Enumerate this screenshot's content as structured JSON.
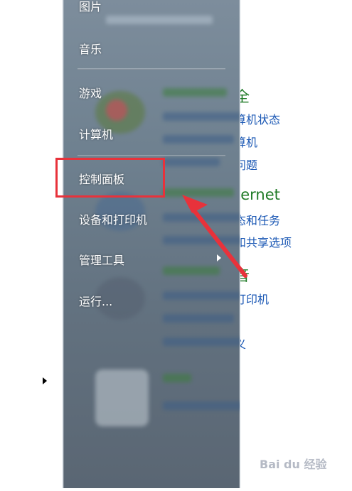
{
  "start_menu": {
    "items": [
      {
        "label": "图片"
      },
      {
        "label": "音乐"
      },
      {
        "label": "游戏"
      },
      {
        "label": "计算机"
      },
      {
        "label": "控制面板"
      },
      {
        "label": "设备和打印机"
      },
      {
        "label": "管理工具"
      },
      {
        "label": "运行..."
      }
    ]
  },
  "control_panel": {
    "lines": [
      {
        "text": "全",
        "kind": "head"
      },
      {
        "text": "算机状态",
        "kind": "link"
      },
      {
        "text": "算机",
        "kind": "link"
      },
      {
        "text": "问题",
        "kind": "link"
      },
      {
        "text": "ternet",
        "kind": "head"
      },
      {
        "text": "态和任务",
        "kind": "link"
      },
      {
        "text": "和共享选项",
        "kind": "link"
      },
      {
        "text": "音",
        "kind": "head"
      },
      {
        "text": "打印机",
        "kind": "link"
      },
      {
        "text": "义",
        "kind": "link"
      }
    ]
  },
  "watermark": "Bai du 经验",
  "colors": {
    "highlight": "#e8323b",
    "arrow": "#e8323b",
    "heading_green": "#1f7a26",
    "link_blue": "#1a57b4"
  }
}
